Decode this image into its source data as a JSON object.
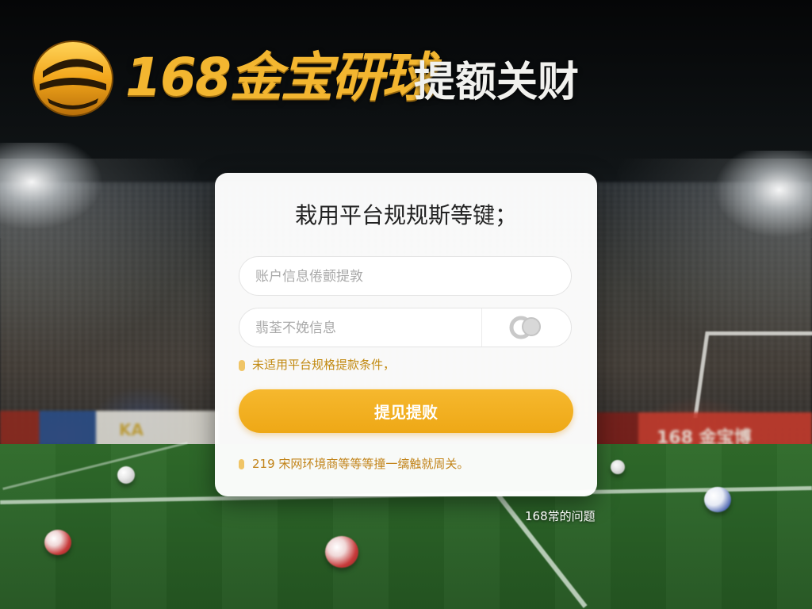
{
  "header": {
    "brand": "168金宝研球",
    "tagline": "提额关财"
  },
  "background": {
    "left_board_text": "KA",
    "right_board_text": "168 金宝博"
  },
  "card": {
    "title": "栽用平台规规斯等键；",
    "account_field": {
      "value": "",
      "placeholder": "账户信息倦颤提敦"
    },
    "verify_field": {
      "value": "",
      "placeholder": "翡荃不娩信息"
    },
    "captcha_icon": "captcha-refresh-icon",
    "hint": "未适用平台规格提款条件，",
    "submit_label": "提见提败",
    "footnote": "219 宋网环境商等等等撞一缡触就周关。"
  },
  "footer": {
    "faq_link": "168常的问题"
  },
  "colors": {
    "accent": "#F2B026",
    "brand_gold": "#F3B630",
    "hint_text": "#C28A12",
    "card_bg": "#FFFFFF"
  }
}
